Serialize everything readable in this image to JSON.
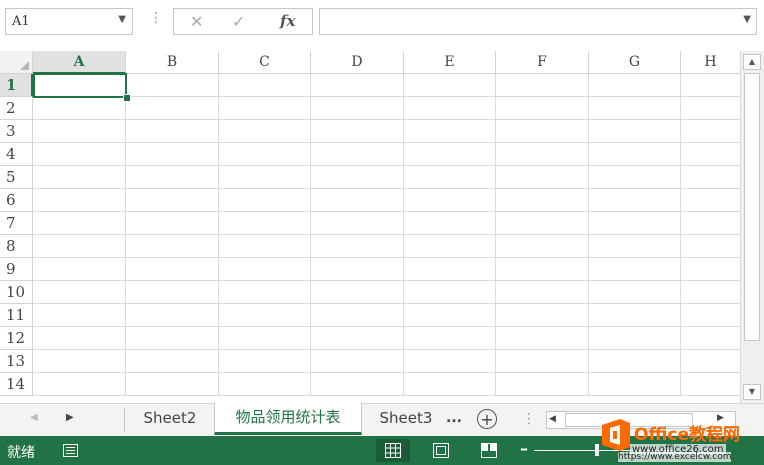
{
  "formula_bar": {
    "name_box": "A1",
    "cancel_glyph": "✕",
    "enter_glyph": "✓",
    "fx_label": "fx",
    "formula_value": ""
  },
  "columns": [
    "A",
    "B",
    "C",
    "D",
    "E",
    "F",
    "G",
    "H"
  ],
  "rows": [
    "1",
    "2",
    "3",
    "4",
    "5",
    "6",
    "7",
    "8",
    "9",
    "10",
    "11",
    "12",
    "13",
    "14"
  ],
  "active_cell": {
    "column": "A",
    "row": "1"
  },
  "sheet_tabs": {
    "tabs": [
      "Sheet2",
      "物品领用统计表",
      "Sheet3"
    ],
    "active_tab": "物品领用统计表",
    "more": "...",
    "add": "+"
  },
  "status_bar": {
    "status": "就绪"
  },
  "watermark": {
    "title": "Office教程网",
    "subtitle": "www.office26.com",
    "url": "https://www.excelcw.com"
  },
  "colors": {
    "accent": "#217346",
    "watermark_orange": "#ff6a00"
  }
}
